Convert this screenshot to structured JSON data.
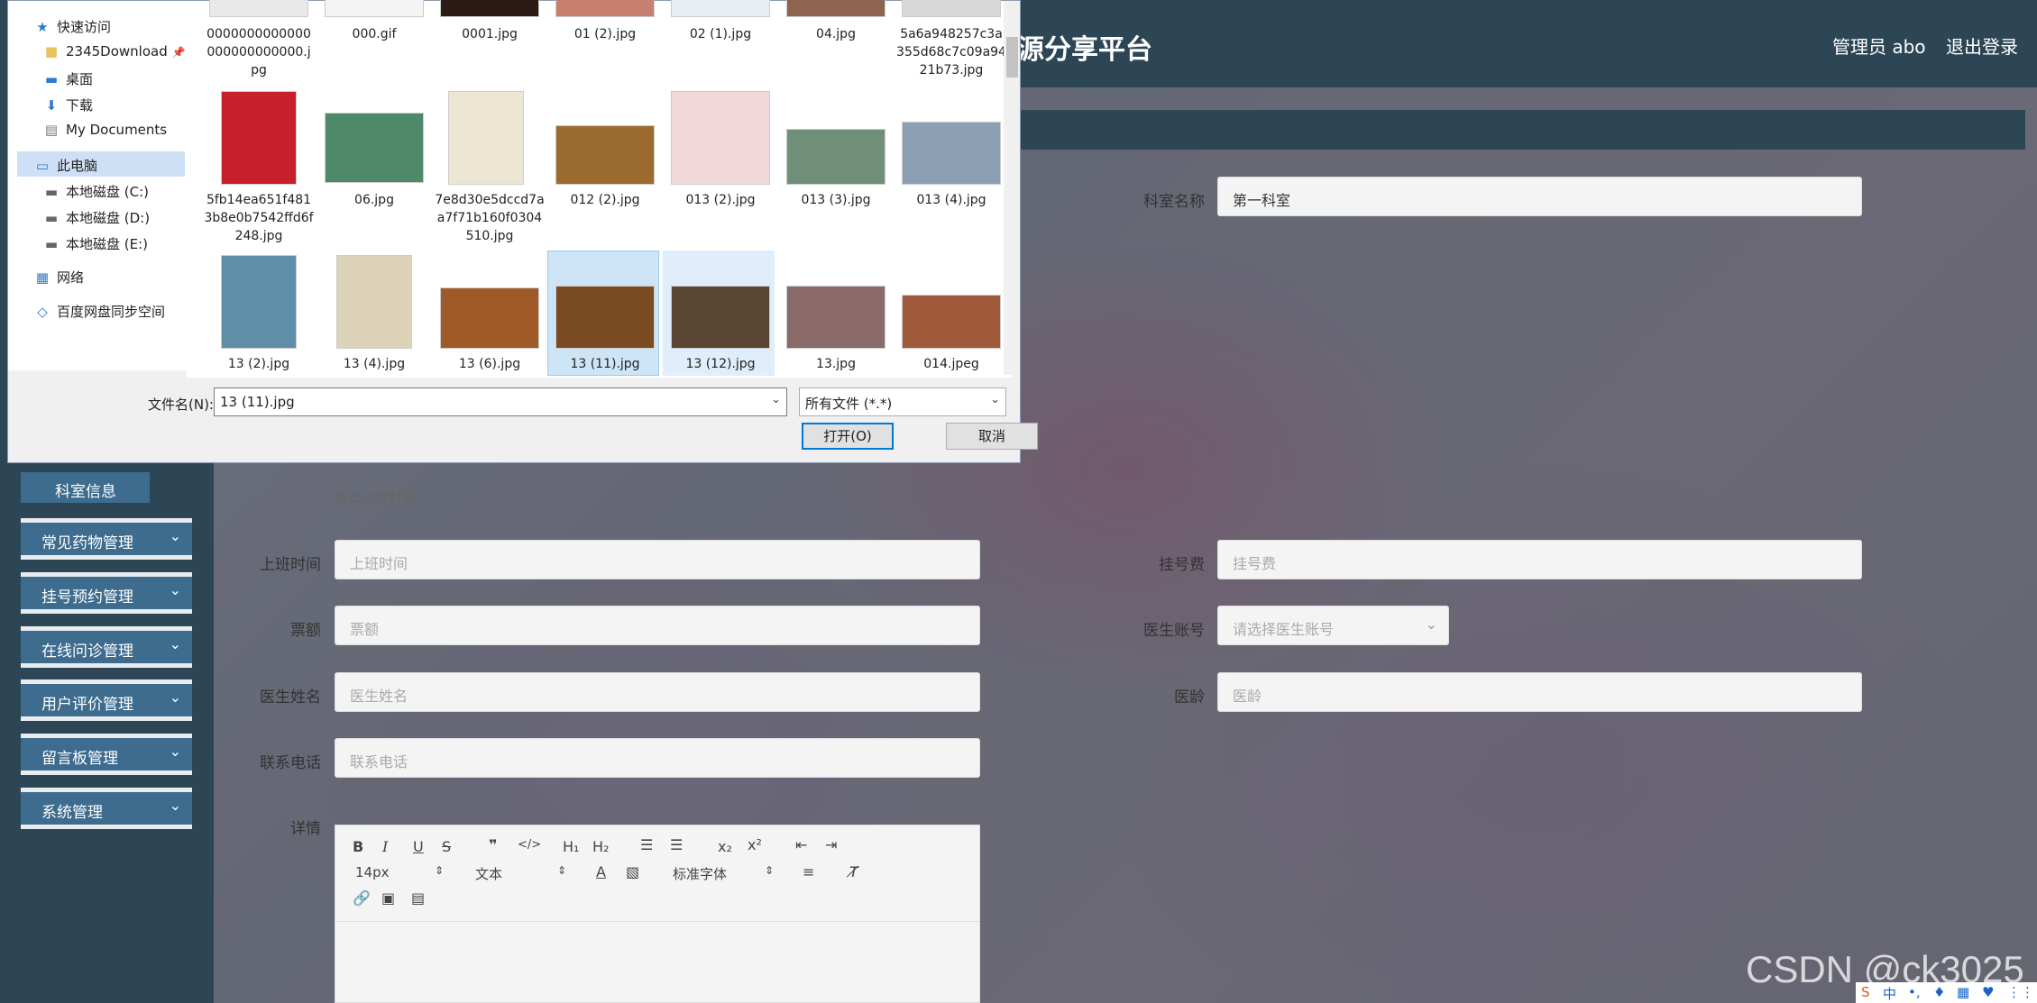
{
  "header": {
    "title": "源分享平台",
    "admin": "管理员 abo",
    "logout": "退出登录"
  },
  "sidebar": {
    "active_sub": "科室信息",
    "menus": [
      "常见药物管理",
      "挂号预约管理",
      "在线问诊管理",
      "用户评价管理",
      "留言板管理",
      "系统管理"
    ]
  },
  "form": {
    "dept_label": "科室名称",
    "dept_value": "第一科室",
    "upload_hint": "点击上传封面",
    "work_time_label": "上班时间",
    "work_time_placeholder": "上班时间",
    "fee_label": "挂号费",
    "fee_placeholder": "挂号费",
    "quota_label": "票额",
    "quota_placeholder": "票额",
    "account_label": "医生账号",
    "account_placeholder": "请选择医生账号",
    "name_label": "医生姓名",
    "name_placeholder": "医生姓名",
    "age_label": "医龄",
    "age_placeholder": "医龄",
    "phone_label": "联系电话",
    "phone_placeholder": "联系电话",
    "detail_label": "详情"
  },
  "editor": {
    "font_size": "14px",
    "block_type": "文本",
    "font_family": "标准字体"
  },
  "dialog": {
    "nav": {
      "quick_access": "快速访问",
      "download2345": "2345Download",
      "desktop": "桌面",
      "downloads": "下载",
      "my_documents": "My Documents",
      "this_pc": "此电脑",
      "drive_c": "本地磁盘 (C:)",
      "drive_d": "本地磁盘 (D:)",
      "drive_e": "本地磁盘 (E:)",
      "network": "网络",
      "baidu": "百度网盘同步空间"
    },
    "files": [
      "0000000000000000000000000.jpg",
      "000.gif",
      "0001.jpg",
      "01 (2).jpg",
      "02 (1).jpg",
      "04.jpg",
      "5a6a948257c3a355d68c7c09a9421b73.jpg",
      "5fb14ea651f4813b8e0b7542ffd6f248.jpg",
      "06.jpg",
      "7e8d30e5dccd7aa7f71b160f0304510.jpg",
      "012 (2).jpg",
      "013 (2).jpg",
      "013 (3).jpg",
      "013 (4).jpg",
      "13 (2).jpg",
      "13 (4).jpg",
      "13 (6).jpg",
      "13 (11).jpg",
      "13 (12).jpg",
      "13.jpg",
      "014.jpeg"
    ],
    "filename_label": "文件名(N):",
    "filename_value": "13 (11).jpg",
    "filetype_value": "所有文件 (*.*)",
    "open_button": "打开(O)",
    "cancel_button": "取消"
  },
  "watermark": "CSDN @ck3025",
  "tray": {
    "ime": "中"
  }
}
